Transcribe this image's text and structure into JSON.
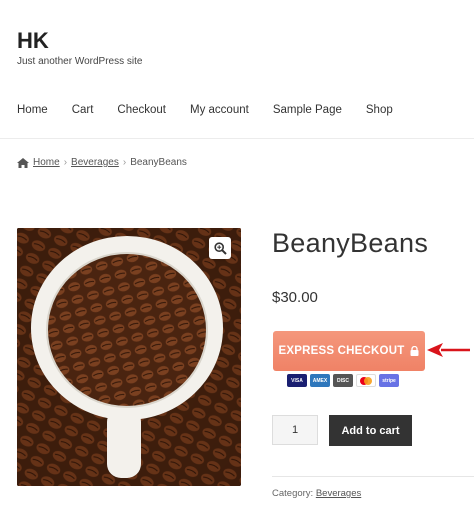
{
  "site": {
    "title": "HK",
    "tagline": "Just another WordPress site"
  },
  "nav": {
    "items": [
      "Home",
      "Cart",
      "Checkout",
      "My account",
      "Sample Page",
      "Shop"
    ]
  },
  "breadcrumb": {
    "home": "Home",
    "category": "Beverages",
    "current": "BeanyBeans",
    "separator": "›"
  },
  "product": {
    "title": "BeanyBeans",
    "price": "$30.00",
    "express_label": "EXPRESS CHECKOUT",
    "quantity": "1",
    "add_to_cart": "Add to cart",
    "category_label": "Category:",
    "category": "Beverages"
  },
  "cards": [
    {
      "name": "VISA",
      "color": "#1a1f71"
    },
    {
      "name": "AMEX",
      "color": "#2e77bc"
    },
    {
      "name": "DISC",
      "color": "#555555"
    },
    {
      "name": "MC",
      "color": "#ffffff"
    },
    {
      "name": "stripe",
      "color": "#6772e5"
    }
  ],
  "colors": {
    "express": "#f08a6c",
    "arrow": "#d9141b",
    "add_cart": "#333333"
  },
  "icons": {
    "home": "home-icon",
    "zoom": "zoom-icon",
    "lock": "lock-icon",
    "arrow": "arrow-left-icon"
  }
}
